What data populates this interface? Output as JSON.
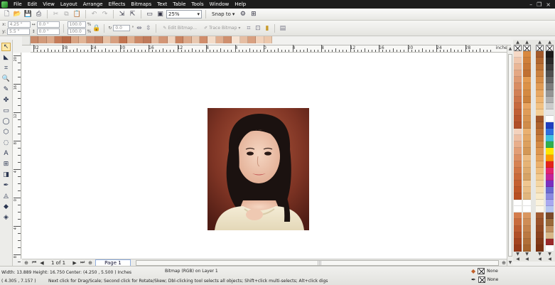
{
  "menu": [
    "File",
    "Edit",
    "View",
    "Layout",
    "Arrange",
    "Effects",
    "Bitmaps",
    "Text",
    "Table",
    "Tools",
    "Window",
    "Help"
  ],
  "toolbar": {
    "zoom_value": "25%",
    "snap_label": "Snap to"
  },
  "propbar": {
    "x": "4.25 \"",
    "y": "5.5 \"",
    "w": "0.0 \"",
    "h": "0.0 \"",
    "scale_w": "100.0",
    "scale_h": "100.0",
    "rotation": "0.0",
    "edit_bitmap": "Edit Bitmap...",
    "trace_bitmap": "Trace Bitmap"
  },
  "ruler": {
    "units": "inches",
    "h_ticks": [
      "32",
      "28",
      "24",
      "20",
      "16",
      "12",
      "8",
      "4",
      "0",
      "4",
      "8",
      "12",
      "16",
      "20",
      "24",
      "28"
    ],
    "v_ticks": [
      "20",
      "16",
      "12",
      "8",
      "4",
      "0",
      "4",
      "8"
    ]
  },
  "pagebar": {
    "page_count": "1 of 1",
    "page_tab": "Page 1"
  },
  "status": {
    "dimensions": "Width: 13.889  Height: 16.750  Center: (4.250 , 5.500 )  Inches",
    "object_info": "Bitmap (RGB) on Layer 1",
    "cursor": "( 4.305 , 7.157 )",
    "hint": "Next click for Drag/Scale; Second click for Rotate/Skew; Dbl-clicking tool selects all objects; Shift+click multi-selects; Alt+click digs",
    "fill_label": "None",
    "outline_label": "None"
  },
  "colors": {
    "menubar_bg": "#1c1c1c",
    "canvas_bg": "#ffffff",
    "page_tab_border": "#8faee0",
    "h_palette": [
      "#c98a6a",
      "#d29a7a",
      "#dca98a",
      "#c57b58",
      "#b86a48",
      "#d9a483",
      "#e2b596",
      "#cf9070",
      "#c48262",
      "#e8c2a6",
      "#d79f7f",
      "#c27450",
      "#e0b090",
      "#cc8866",
      "#bf7a5a",
      "#e5bba0",
      "#d39575",
      "#f0d4bf",
      "#c98360",
      "#dba889",
      "#e9c9b1",
      "#d18d6b",
      "#f3dcc9",
      "#e0ae90",
      "#cf8f6e",
      "#f6e3d3",
      "#e6bea3",
      "#d9a080",
      "#f1d2bb",
      "#ecc8ad"
    ],
    "pal1": [
      "#f6d9c6",
      "#f0c7ad",
      "#eab797",
      "#e4a884",
      "#de9a72",
      "#d88d63",
      "#d28055",
      "#cc7449",
      "#c6693e",
      "#c05f35",
      "#b8562e",
      "#b04e28",
      "#f4d2bd",
      "#eebfa3",
      "#e8ae8b",
      "#e29e76",
      "#dc8f63",
      "#d68252",
      "#d07545",
      "#ca6a3a",
      "#c46031",
      "#be5729",
      "#b84f23",
      "#ffffff",
      "#ffffff",
      "#d47c4c",
      "#c86b3d",
      "#bc5c31",
      "#b04f27",
      "#a4441f",
      "#983a19"
    ],
    "pal2": [
      "#d8883e",
      "#d0803a",
      "#c87836",
      "#c07032",
      "#e39a50",
      "#dc9248",
      "#d48a42",
      "#cc823c",
      "#e8a460",
      "#e09c58",
      "#d89450",
      "#d08c4a",
      "#eab070",
      "#e4a866",
      "#dca05e",
      "#d49856",
      "#edbb80",
      "#e6b376",
      "#deab6e",
      "#d6a366",
      "#f0c690",
      "#e9be86",
      "#e1b67e",
      "#ffffff",
      "#ffffff",
      "#d99760",
      "#cf8d56",
      "#c5834c",
      "#bb7942",
      "#b16f38",
      "#a7652e"
    ],
    "pal3": [
      "#a35a2a",
      "#b0672f",
      "#bd7436",
      "#ca813e",
      "#d68e48",
      "#e09b54",
      "#e8a862",
      "#eeb572",
      "#f2c283",
      "#f5cf96",
      "#a05528",
      "#ad622d",
      "#ba6f34",
      "#c77c3b",
      "#d38944",
      "#dd964f",
      "#e5a35c",
      "#ebb06b",
      "#efbd7c",
      "#f2ca8f",
      "#f4d6a3",
      "#f6e0b6",
      "#f8eac9",
      "#faf2dc",
      "#fbf7ec",
      "#a15a30",
      "#9a522a",
      "#924a24",
      "#8a421e",
      "#823a18",
      "#7a3212"
    ],
    "pal4": [
      "#1a1a1a",
      "#2a2a2a",
      "#3c3c3c",
      "#505050",
      "#666666",
      "#7d7d7d",
      "#959595",
      "#b0b0b0",
      "#cccccc",
      "#e6e6e6",
      "#ffffff",
      "#1f3fbf",
      "#2f6fdf",
      "#3fbfdf",
      "#2fae4f",
      "#ffe600",
      "#ff9a00",
      "#e2231a",
      "#e2236f",
      "#c2239a",
      "#7a2fbf",
      "#6a6ad0",
      "#8a8ae0",
      "#a8a8f0",
      "#b6c6f0",
      "#7a4a2a",
      "#9a6a3a",
      "#c09060",
      "#d8b888",
      "#9a2a2a",
      "#ffffff"
    ]
  }
}
